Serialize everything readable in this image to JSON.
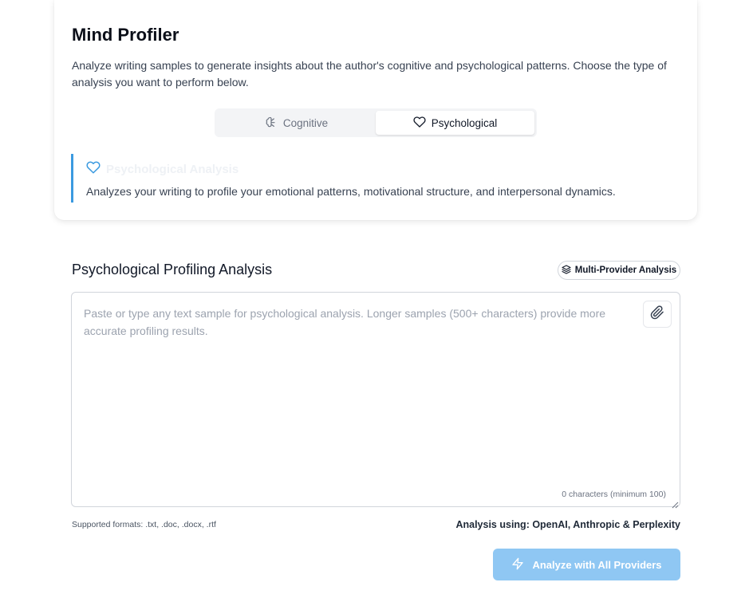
{
  "header": {
    "title": "Mind Profiler",
    "description": "Analyze writing samples to generate insights about the author's cognitive and psychological patterns. Choose the type of analysis you want to perform below."
  },
  "tabs": [
    {
      "label": "Cognitive",
      "icon": "brain-icon",
      "active": false
    },
    {
      "label": "Psychological",
      "icon": "heart-icon",
      "active": true
    }
  ],
  "info": {
    "icon": "heart-icon",
    "title": "Psychological Analysis",
    "description": "Analyzes your writing to profile your emotional patterns, motivational structure, and interpersonal dynamics."
  },
  "analysis": {
    "title": "Psychological Profiling Analysis",
    "badge_label": "Multi-Provider Analysis",
    "badge_icon": "layers-icon",
    "input_value": "",
    "input_placeholder": "Paste or type any text sample for psychological analysis. Longer samples (500+ characters) provide more accurate profiling results.",
    "attach_icon": "paperclip-icon",
    "char_count": "0 characters (minimum 100)",
    "formats": "Supported formats: .txt, .doc, .docx, .rtf",
    "providers": "Analysis using: OpenAI, Anthropic & Perplexity",
    "button_label": "Analyze with All Providers",
    "button_icon": "bolt-icon",
    "button_disabled": true
  },
  "colors": {
    "accent": "#3b9ae0",
    "button_disabled": "#8fc7f3"
  }
}
